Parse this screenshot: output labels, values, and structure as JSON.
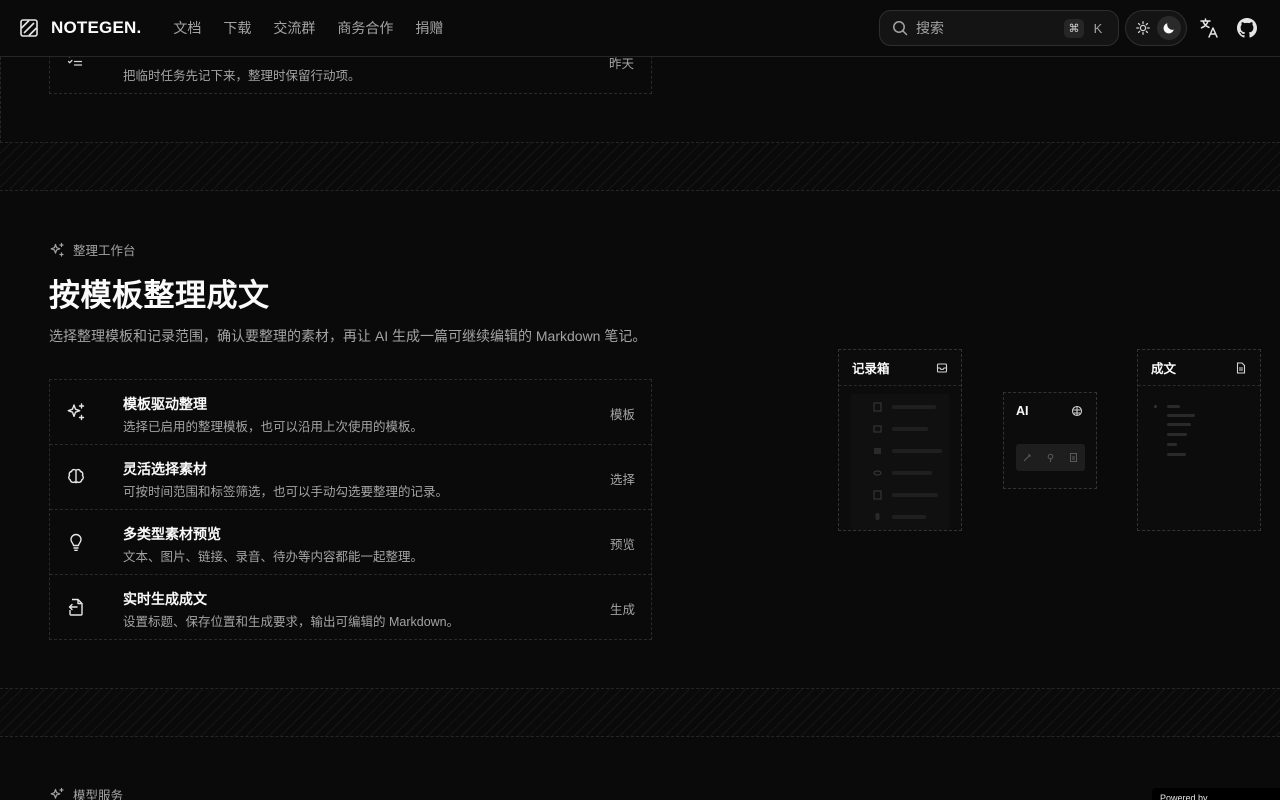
{
  "header": {
    "brand": "NOTEGEN.",
    "nav": [
      "文档",
      "下载",
      "交流群",
      "商务合作",
      "捐赠"
    ],
    "search_placeholder": "搜索",
    "shortcut_modifier": "⌘",
    "shortcut_key": "K"
  },
  "top_list": {
    "item_desc": "把临时任务先记下来，整理时保留行动项。",
    "item_tag": "昨天"
  },
  "organize_section": {
    "eyebrow": "整理工作台",
    "title": "按模板整理成文",
    "description": "选择整理模板和记录范围，确认要整理的素材，再让 AI 生成一篇可继续编辑的 Markdown 笔记。",
    "features": [
      {
        "title": "模板驱动整理",
        "desc": "选择已启用的整理模板，也可以沿用上次使用的模板。",
        "tag": "模板",
        "icon": "sparkles-icon"
      },
      {
        "title": "灵活选择素材",
        "desc": "可按时间范围和标签筛选，也可以手动勾选要整理的记录。",
        "tag": "选择",
        "icon": "brain-icon"
      },
      {
        "title": "多类型素材预览",
        "desc": "文本、图片、链接、录音、待办等内容都能一起整理。",
        "tag": "预览",
        "icon": "lightbulb-icon"
      },
      {
        "title": "实时生成成文",
        "desc": "设置标题、保存位置和生成要求，输出可编辑的 Markdown。",
        "tag": "生成",
        "icon": "file-output-icon"
      }
    ],
    "diagram": {
      "inbox_title": "记录箱",
      "ai_title": "AI",
      "output_title": "成文"
    }
  },
  "model_section": {
    "eyebrow": "模型服务"
  },
  "footer_badge": "Powered by"
}
